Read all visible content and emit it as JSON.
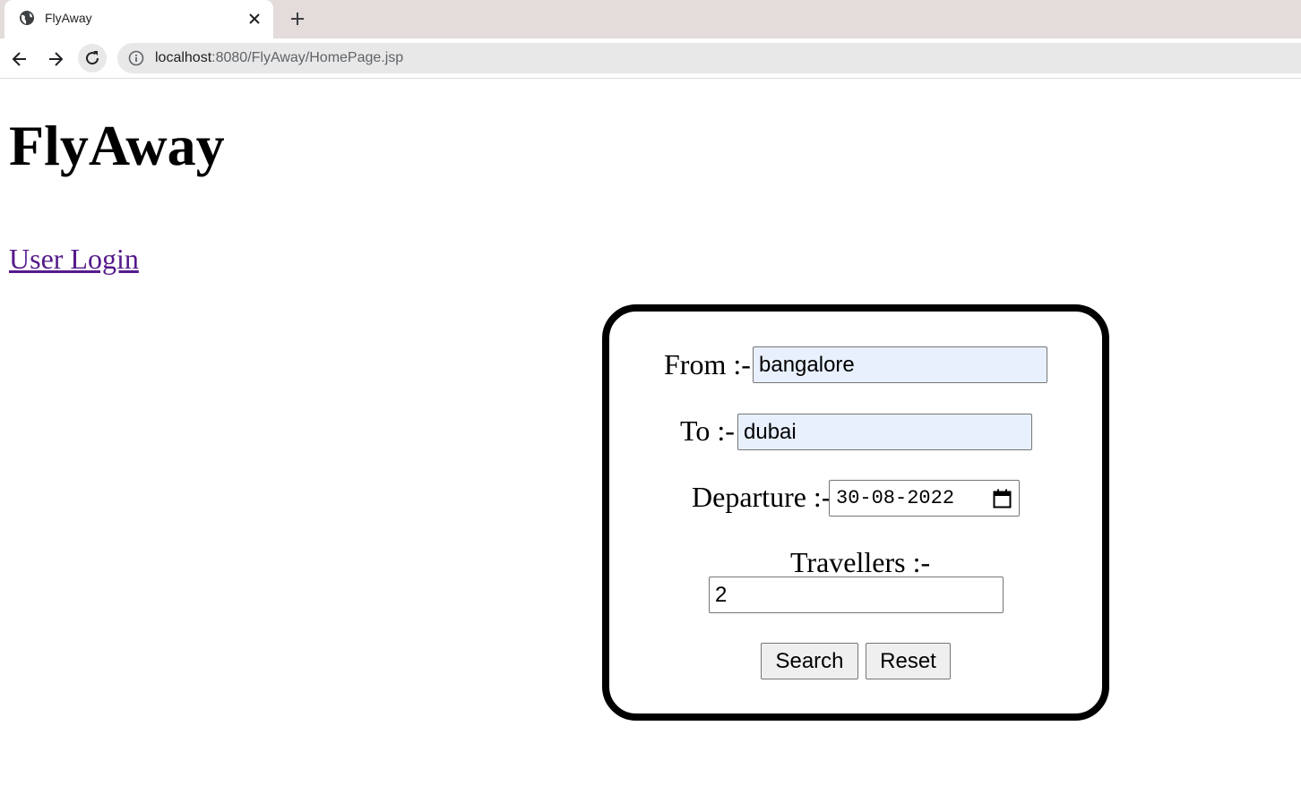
{
  "browser": {
    "tab_title": "FlyAway",
    "url_host": "localhost",
    "url_path": ":8080/FlyAway/HomePage.jsp"
  },
  "page": {
    "title": "FlyAway",
    "login_link": "User Login"
  },
  "form": {
    "from_label": "From :-",
    "from_value": "bangalore",
    "to_label": "To :-",
    "to_value": "dubai",
    "departure_label": "Departure :-",
    "departure_value": "30-08-2022",
    "travellers_label": "Travellers :-",
    "travellers_value": "2",
    "search_label": "Search",
    "reset_label": "Reset"
  },
  "colors": {
    "visited_link": "#551a8b",
    "autofill_bg": "#e8f0fe",
    "tabstrip_bg": "#e3dcda"
  }
}
